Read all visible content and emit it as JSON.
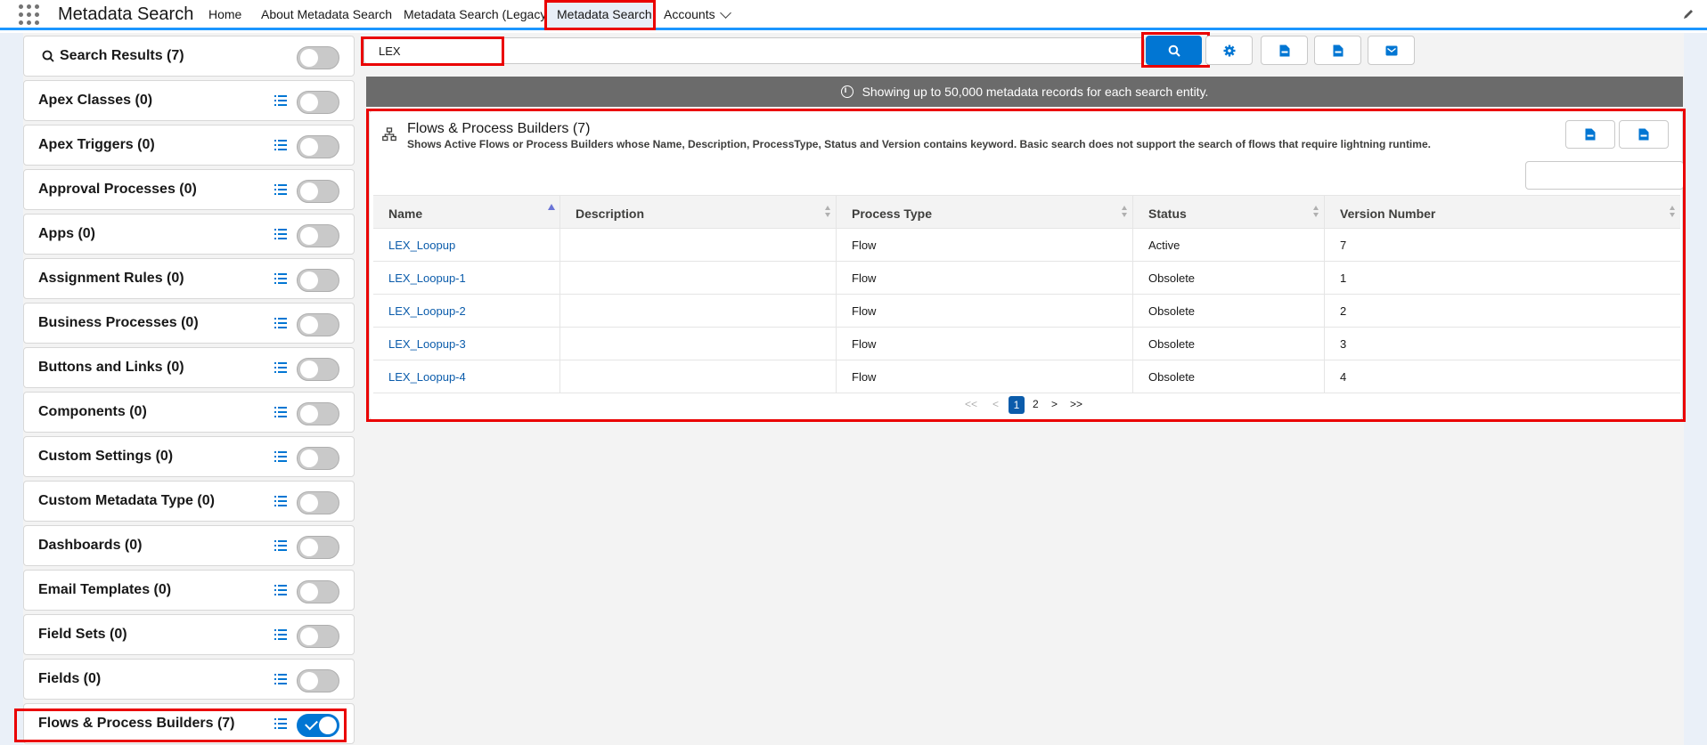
{
  "app": {
    "name": "Metadata Search"
  },
  "nav": {
    "items": [
      "Home",
      "About Metadata Search",
      "Metadata Search (Legacy)",
      "Metadata Search",
      "Accounts"
    ]
  },
  "search": {
    "value": "LEX",
    "placeholder": ""
  },
  "banner": {
    "text": "Showing up to 50,000 metadata records for each search entity."
  },
  "sidebar": {
    "items": [
      {
        "label": "Search Results (7)",
        "on": false
      },
      {
        "label": "Apex Classes (0)",
        "on": false
      },
      {
        "label": "Apex Triggers (0)",
        "on": false
      },
      {
        "label": "Approval Processes (0)",
        "on": false
      },
      {
        "label": "Apps (0)",
        "on": false
      },
      {
        "label": "Assignment Rules (0)",
        "on": false
      },
      {
        "label": "Business Processes (0)",
        "on": false
      },
      {
        "label": "Buttons and Links (0)",
        "on": false
      },
      {
        "label": "Components (0)",
        "on": false
      },
      {
        "label": "Custom Settings (0)",
        "on": false
      },
      {
        "label": "Custom Metadata Type (0)",
        "on": false
      },
      {
        "label": "Dashboards (0)",
        "on": false
      },
      {
        "label": "Email Templates (0)",
        "on": false
      },
      {
        "label": "Field Sets (0)",
        "on": false
      },
      {
        "label": "Fields (0)",
        "on": false
      },
      {
        "label": "Flows & Process Builders (7)",
        "on": true
      }
    ]
  },
  "card": {
    "title": "Flows & Process Builders (7)",
    "subtitle": "Shows Active Flows or Process Builders whose Name, Description, ProcessType, Status and Version contains keyword. Basic search does not support the search of flows that require lightning runtime.",
    "columns": [
      "Name",
      "Description",
      "Process Type",
      "Status",
      "Version Number"
    ],
    "rows": [
      {
        "name": "LEX_Loopup",
        "description": "",
        "process_type": "Flow",
        "status": "Active",
        "version": "7"
      },
      {
        "name": "LEX_Loopup-1",
        "description": "",
        "process_type": "Flow",
        "status": "Obsolete",
        "version": "1"
      },
      {
        "name": "LEX_Loopup-2",
        "description": "",
        "process_type": "Flow",
        "status": "Obsolete",
        "version": "2"
      },
      {
        "name": "LEX_Loopup-3",
        "description": "",
        "process_type": "Flow",
        "status": "Obsolete",
        "version": "3"
      },
      {
        "name": "LEX_Loopup-4",
        "description": "",
        "process_type": "Flow",
        "status": "Obsolete",
        "version": "4"
      }
    ]
  },
  "pager": {
    "first": "<<",
    "prev": "<",
    "pages": [
      "1",
      "2"
    ],
    "current": "1",
    "next": ">",
    "last": ">>"
  },
  "colors": {
    "brand": "#0176d3",
    "link": "#0b5cab",
    "highlight": "#ea0000",
    "banner": "#6b6b6b"
  }
}
